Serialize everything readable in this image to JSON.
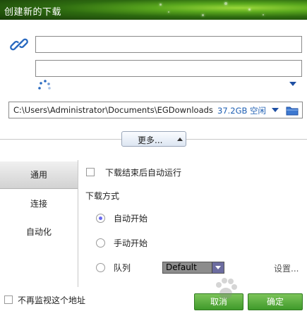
{
  "window": {
    "title": "创建新的下载"
  },
  "url_fields": {
    "primary_value": "",
    "secondary_value": ""
  },
  "save_path": {
    "path": "C:\\Users\\Administrator\\Documents\\EGDownloads",
    "free_space": "37.2GB 空闲"
  },
  "more_button": {
    "label": "更多..."
  },
  "sidebar": {
    "items": [
      {
        "label": "通用",
        "active": true
      },
      {
        "label": "连接",
        "active": false
      },
      {
        "label": "自动化",
        "active": false
      }
    ]
  },
  "general": {
    "auto_run_label": "下载结束后自动运行",
    "auto_run_checked": false,
    "mode_heading": "下载方式",
    "modes": [
      {
        "label": "自动开始",
        "selected": true
      },
      {
        "label": "手动开始",
        "selected": false
      },
      {
        "label": "队列",
        "selected": false
      }
    ],
    "queue_value": "Default",
    "settings_link": "设置..."
  },
  "footer": {
    "no_monitor_label": "不再监视这个地址",
    "no_monitor_checked": false,
    "cancel_label": "取消",
    "ok_label": "确定"
  },
  "colors": {
    "accent_green": "#3f9a2a",
    "link_blue": "#1e5fb3",
    "radio_dot": "#6a6af0"
  }
}
